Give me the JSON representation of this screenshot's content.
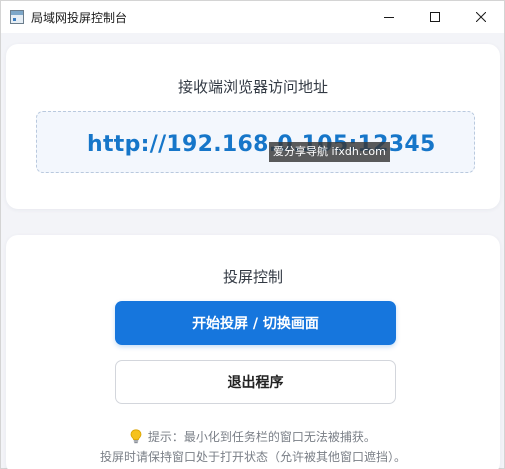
{
  "window": {
    "title": "局域网投屏控制台",
    "icon": "app-window-icon",
    "controls": [
      "minimize-icon",
      "maximize-icon",
      "close-icon"
    ]
  },
  "receiver": {
    "heading": "接收端浏览器访问地址",
    "url": "http://192.168.0.105:12345",
    "watermark": "爱分享导航 ifxdh.com"
  },
  "control": {
    "heading": "投屏控制",
    "start_button": "开始投屏 / 切换画面",
    "exit_button": "退出程序",
    "hint_line1": "提示：最小化到任务栏的窗口无法被捕获。",
    "hint_line2": "投屏时请保持窗口处于打开状态（允许被其他窗口遮挡）。",
    "hint_icon": "lightbulb-icon"
  },
  "colors": {
    "accent": "#1676dd",
    "url_text": "#1676c9",
    "background": "#f3f4f8"
  }
}
